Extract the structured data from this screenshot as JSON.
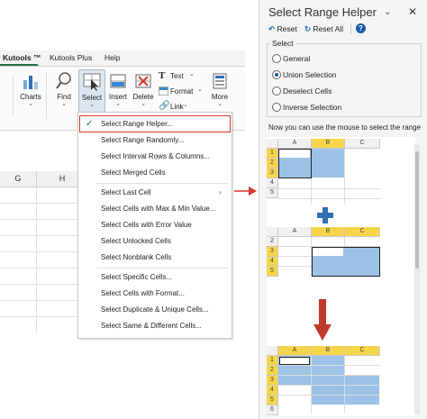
{
  "ribbon_tabs": [
    "Kutools ™",
    "Kutools Plus",
    "Help"
  ],
  "ribbon_buttons": {
    "charts": "Charts",
    "find": "Find",
    "select": "Select",
    "insert": "Insert",
    "delete": "Delete",
    "text": "Text",
    "format": "Format",
    "link": "Link",
    "more": "More"
  },
  "columns": [
    "G",
    "H"
  ],
  "menu": {
    "items": [
      "Select Range Helper...",
      "Select Range Randomly...",
      "Select Interval Rows & Columns...",
      "Select Merged Cells",
      "Select Last Cell",
      "Select Cells with Max & Min Value...",
      "Select Cells with Error Value",
      "Select Unlocked Cells",
      "Select Nonblank Cells",
      "Select Specific Cells...",
      "Select Cells with Format...",
      "Select Duplicate & Unique Cells...",
      "Select Same & Different Cells..."
    ]
  },
  "panel": {
    "title": "Select Range Helper",
    "reset": "Reset",
    "reset_all": "Reset All",
    "select_legend": "Select",
    "options": [
      "General",
      "Union Selection",
      "Deselect Cells",
      "Inverse Selection"
    ],
    "selected_option": "Union Selection",
    "hint": "Now you can use the mouse to select the range"
  },
  "mini_sheet": {
    "cols": [
      "A",
      "B",
      "C"
    ],
    "rows": [
      "1",
      "2",
      "3",
      "4",
      "5",
      "6"
    ]
  },
  "colors": {
    "accent_red": "#d9372b",
    "selection_blue": "#9cc3e6",
    "header_yellow": "#f7d54a",
    "plus_blue": "#2f6fb3"
  }
}
